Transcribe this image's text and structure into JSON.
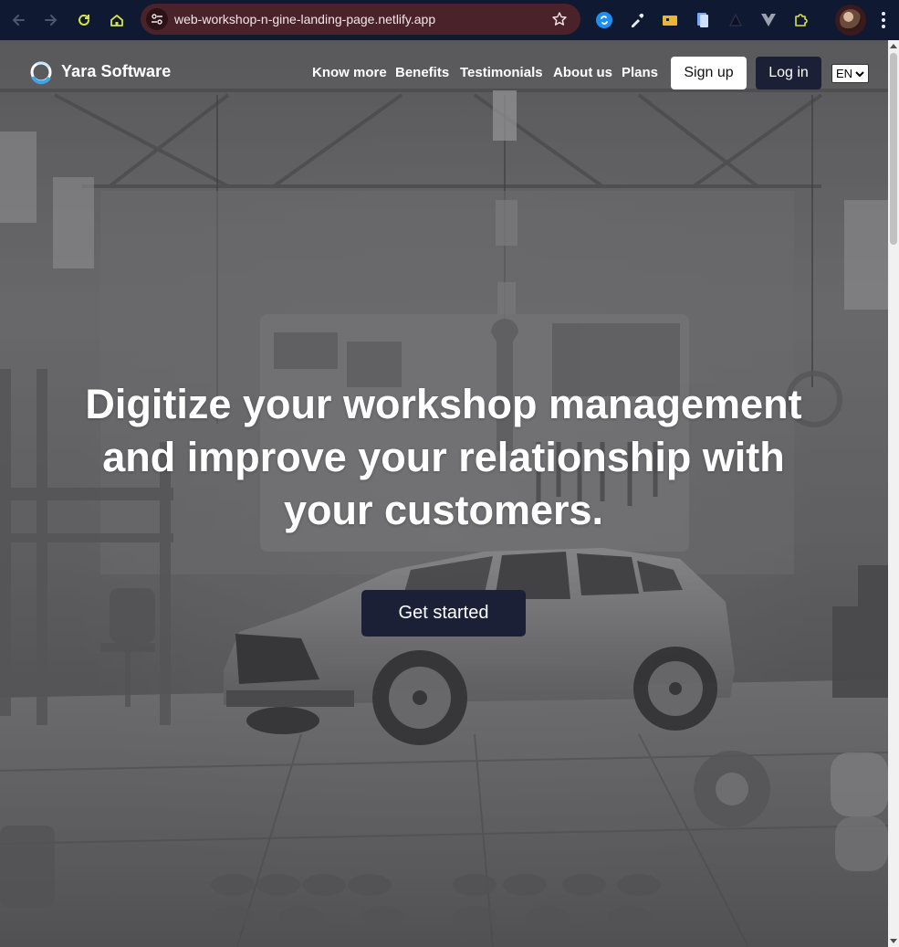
{
  "browser": {
    "url": "web-workshop-n-gine-landing-page.netlify.app",
    "icons": [
      "back-icon",
      "forward-icon",
      "reload-icon",
      "home-icon",
      "site-settings-icon",
      "bookmark-star-icon",
      "extension-icons",
      "profile-avatar",
      "menu-icon"
    ],
    "colors": {
      "toolbar": "#0f1931",
      "omnibox": "#4a2229"
    }
  },
  "nav": {
    "brand": "Yara Software",
    "links": [
      "Know more",
      "Benefits",
      "Testimonials",
      "About us",
      "Plans"
    ],
    "signup": "Sign up",
    "login": "Log in",
    "language": "EN"
  },
  "hero": {
    "line1": "Digitize your workshop management",
    "line2": "and improve your relationship with",
    "line3": "your customers.",
    "cta": "Get started"
  },
  "colors": {
    "primary_dark": "#1b2036",
    "white": "#ffffff"
  }
}
